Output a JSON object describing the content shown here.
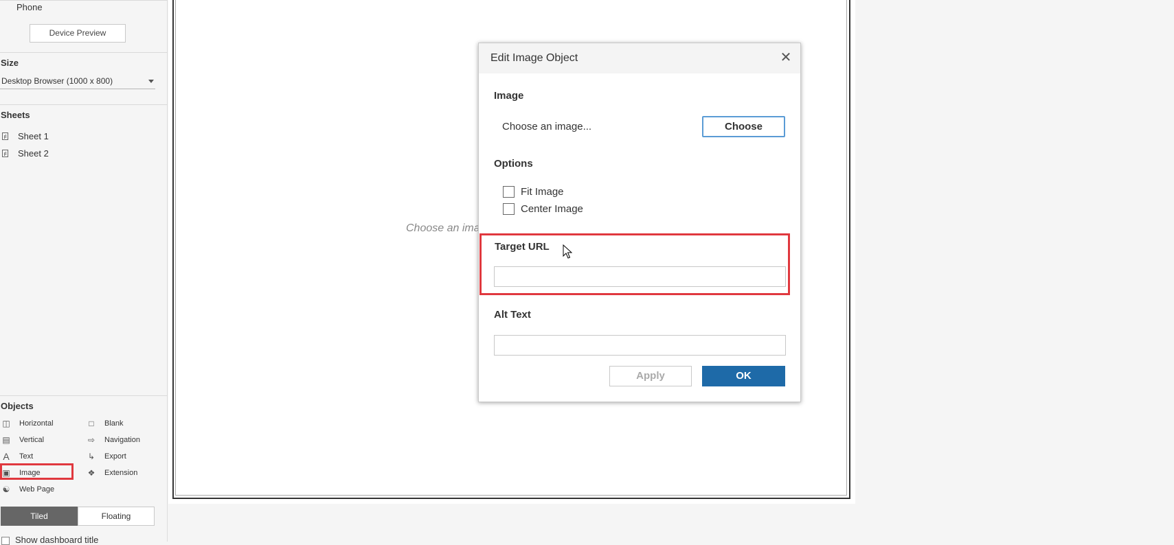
{
  "sidebar": {
    "phone_label": "Phone",
    "device_preview_label": "Device Preview",
    "size_title": "Size",
    "size_value": "Desktop Browser (1000 x 800)",
    "sheets_title": "Sheets",
    "sheets": [
      "Sheet 1",
      "Sheet 2"
    ],
    "objects_title": "Objects",
    "objects": {
      "horizontal": "Horizontal",
      "blank": "Blank",
      "vertical": "Vertical",
      "navigation": "Navigation",
      "text": "Text",
      "export": "Export",
      "image": "Image",
      "extension": "Extension",
      "web_page": "Web Page"
    },
    "tiled_label": "Tiled",
    "floating_label": "Floating",
    "show_title_label": "Show dashboard title"
  },
  "canvas": {
    "placeholder": "Choose an image..."
  },
  "dialog": {
    "title": "Edit Image Object",
    "image_label": "Image",
    "choose_prompt": "Choose an image...",
    "choose_button": "Choose",
    "options_label": "Options",
    "fit_image_label": "Fit Image",
    "center_image_label": "Center Image",
    "target_url_label": "Target URL",
    "target_url_value": "",
    "alt_text_label": "Alt Text",
    "alt_text_value": "",
    "apply_button": "Apply",
    "ok_button": "OK"
  },
  "colors": {
    "highlight": "#e0383e",
    "ok_button": "#1e6aa8",
    "active_segment": "#666666"
  }
}
